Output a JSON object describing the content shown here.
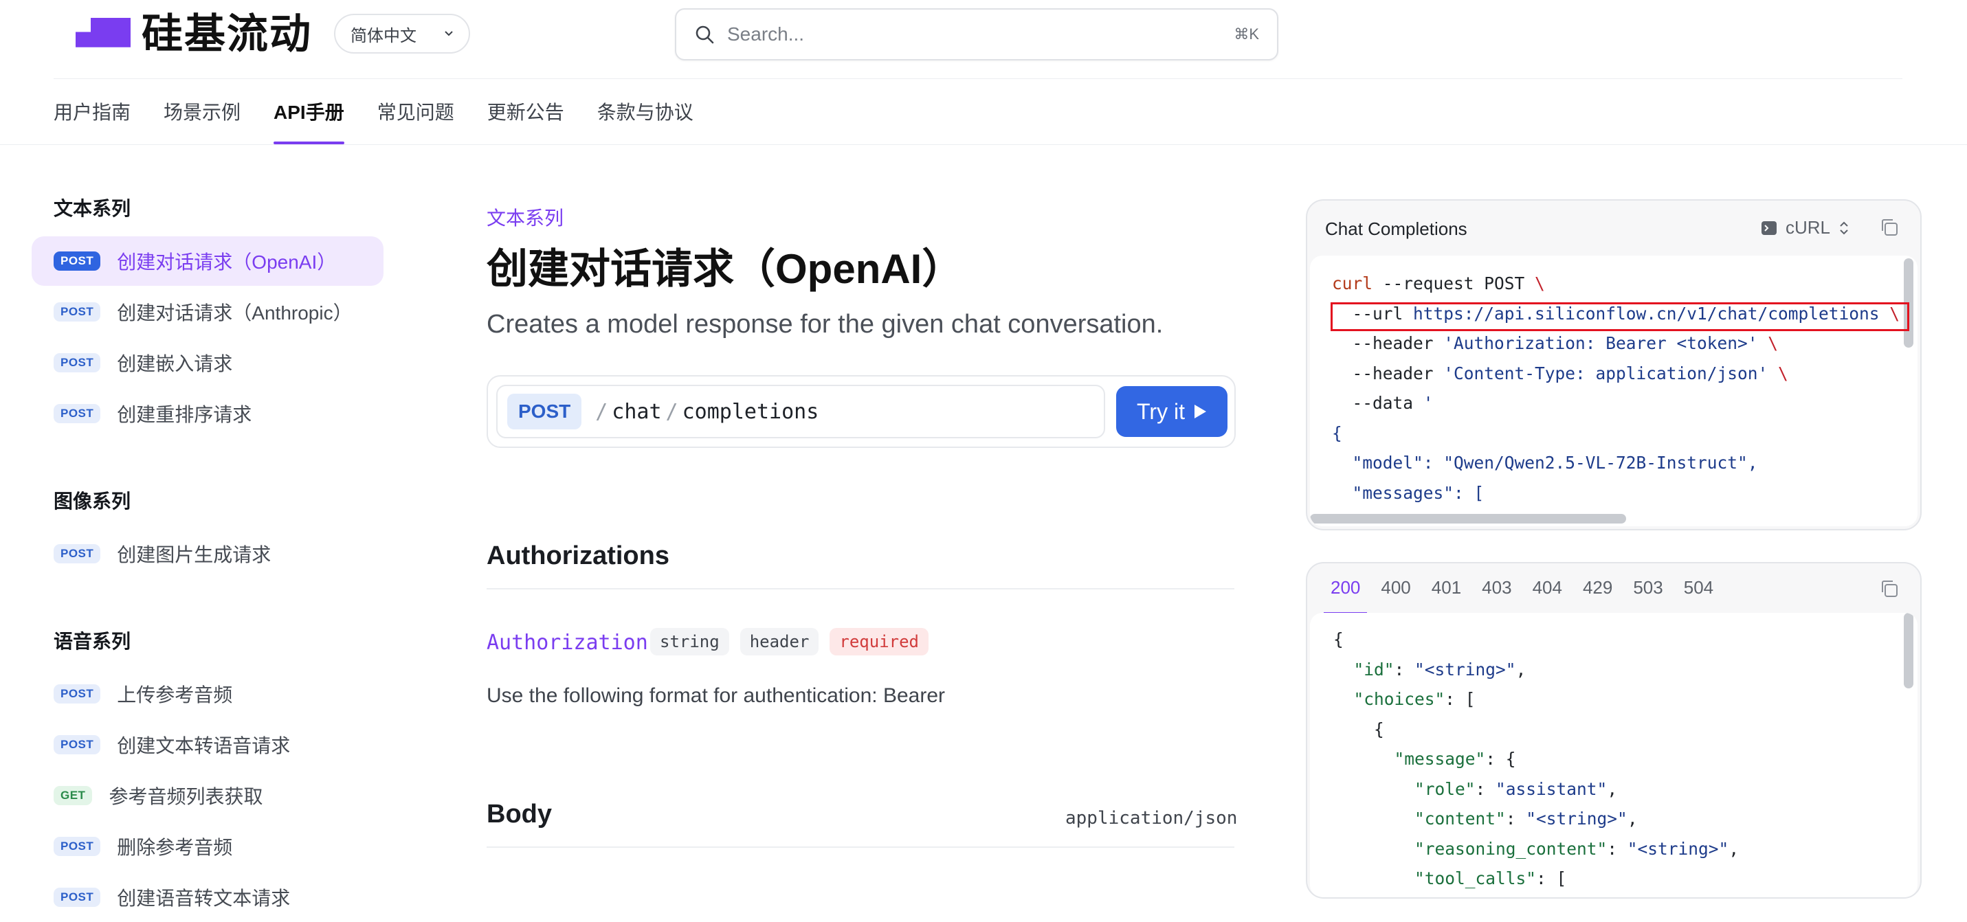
{
  "header": {
    "brand": "硅基流动",
    "language": "简体中文",
    "search_placeholder": "Search...",
    "search_shortcut": "⌘K",
    "brand_color": "#7a3df0"
  },
  "tabs": [
    {
      "label": "用户指南"
    },
    {
      "label": "场景示例"
    },
    {
      "label": "API手册"
    },
    {
      "label": "常见问题"
    },
    {
      "label": "更新公告"
    },
    {
      "label": "条款与协议"
    }
  ],
  "sidebar": {
    "sections": [
      {
        "title": "文本系列",
        "items": [
          {
            "method": "POST",
            "label": "创建对话请求（OpenAI）"
          },
          {
            "method": "POST",
            "label": "创建对话请求（Anthropic）"
          },
          {
            "method": "POST",
            "label": "创建嵌入请求"
          },
          {
            "method": "POST",
            "label": "创建重排序请求"
          }
        ]
      },
      {
        "title": "图像系列",
        "items": [
          {
            "method": "POST",
            "label": "创建图片生成请求"
          }
        ]
      },
      {
        "title": "语音系列",
        "items": [
          {
            "method": "POST",
            "label": "上传参考音频"
          },
          {
            "method": "POST",
            "label": "创建文本转语音请求"
          },
          {
            "method": "GET",
            "label": "参考音频列表获取"
          },
          {
            "method": "POST",
            "label": "删除参考音频"
          },
          {
            "method": "POST",
            "label": "创建语音转文本请求"
          }
        ]
      }
    ]
  },
  "main": {
    "breadcrumb": "文本系列",
    "title": "创建对话请求（OpenAI）",
    "subtitle": "Creates a model response for the given chat conversation.",
    "endpoint": {
      "method": "POST",
      "path": [
        "chat",
        "completions"
      ],
      "try_label": "Try it"
    },
    "authorizations": {
      "heading": "Authorizations",
      "name": "Authorization",
      "type": "string",
      "location": "header",
      "required": "required",
      "description": "Use the following format for authentication: Bearer"
    },
    "body": {
      "heading": "Body",
      "content_type": "application/json"
    }
  },
  "request_panel": {
    "title": "Chat Completions",
    "language": "cURL",
    "lines": [
      {
        "parts": [
          [
            "k-red",
            "curl"
          ],
          [
            "k-dark",
            " --request POST "
          ],
          [
            "k-esc",
            "\\"
          ]
        ]
      },
      {
        "parts": [
          [
            "k-dark",
            "  --url "
          ],
          [
            "k-str",
            "https://api.siliconflow.cn/v1/chat/completions"
          ],
          [
            "k-dark",
            " "
          ],
          [
            "k-esc",
            "\\"
          ]
        ]
      },
      {
        "parts": [
          [
            "k-dark",
            "  --header "
          ],
          [
            "k-str",
            "'Authorization: Bearer <token>'"
          ],
          [
            "k-dark",
            " "
          ],
          [
            "k-esc",
            "\\"
          ]
        ]
      },
      {
        "parts": [
          [
            "k-dark",
            "  --header "
          ],
          [
            "k-str",
            "'Content-Type: application/json'"
          ],
          [
            "k-dark",
            " "
          ],
          [
            "k-esc",
            "\\"
          ]
        ]
      },
      {
        "parts": [
          [
            "k-dark",
            "  --data "
          ],
          [
            "k-str",
            "'"
          ]
        ]
      },
      {
        "parts": [
          [
            "k-str",
            "{"
          ]
        ]
      },
      {
        "parts": [
          [
            "k-str",
            "  \"model\": \"Qwen/Qwen2.5-VL-72B-Instruct\","
          ]
        ]
      },
      {
        "parts": [
          [
            "k-str",
            "  \"messages\": ["
          ]
        ]
      }
    ]
  },
  "response_panel": {
    "status_tabs": [
      "200",
      "400",
      "401",
      "403",
      "404",
      "429",
      "503",
      "504"
    ],
    "active_tab": "200",
    "lines": [
      {
        "parts": [
          [
            "j-p",
            "{"
          ]
        ]
      },
      {
        "parts": [
          [
            "j-p",
            "  "
          ],
          [
            "j-key",
            "\"id\""
          ],
          [
            "j-p",
            ": "
          ],
          [
            "j-str",
            "\"<string>\""
          ],
          [
            "j-p",
            ","
          ]
        ]
      },
      {
        "parts": [
          [
            "j-p",
            "  "
          ],
          [
            "j-key",
            "\"choices\""
          ],
          [
            "j-p",
            ": ["
          ]
        ]
      },
      {
        "parts": [
          [
            "j-p",
            "    {"
          ]
        ]
      },
      {
        "parts": [
          [
            "j-p",
            "      "
          ],
          [
            "j-key",
            "\"message\""
          ],
          [
            "j-p",
            ": {"
          ]
        ]
      },
      {
        "parts": [
          [
            "j-p",
            "        "
          ],
          [
            "j-key",
            "\"role\""
          ],
          [
            "j-p",
            ": "
          ],
          [
            "j-str",
            "\"assistant\""
          ],
          [
            "j-p",
            ","
          ]
        ]
      },
      {
        "parts": [
          [
            "j-p",
            "        "
          ],
          [
            "j-key",
            "\"content\""
          ],
          [
            "j-p",
            ": "
          ],
          [
            "j-str",
            "\"<string>\""
          ],
          [
            "j-p",
            ","
          ]
        ]
      },
      {
        "parts": [
          [
            "j-p",
            "        "
          ],
          [
            "j-key",
            "\"reasoning_content\""
          ],
          [
            "j-p",
            ": "
          ],
          [
            "j-str",
            "\"<string>\""
          ],
          [
            "j-p",
            ","
          ]
        ]
      },
      {
        "parts": [
          [
            "j-p",
            "        "
          ],
          [
            "j-key",
            "\"tool_calls\""
          ],
          [
            "j-p",
            ": ["
          ]
        ]
      }
    ]
  }
}
